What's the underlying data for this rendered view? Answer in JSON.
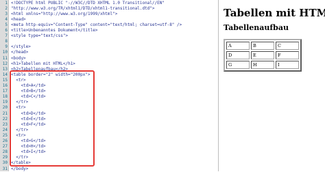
{
  "editor": {
    "lines": [
      {
        "n": "1",
        "text": "<!DOCTYPE html PUBLIC \"-//W3C//DTD XHTML 1.0 Transitional//EN\""
      },
      {
        "n": "2",
        "text": "\"http://www.w3.org/TR/xhtml1/DTD/xhtml1-transitional.dtd\">"
      },
      {
        "n": "3",
        "text": "<html xmlns=\"http://www.w3.org/1999/xhtml\">"
      },
      {
        "n": "4",
        "text": "<head>"
      },
      {
        "n": "5",
        "text": "<meta http-equiv=\"Content-Type\" content=\"text/html; charset=utf-8\" />"
      },
      {
        "n": "6",
        "text": "<title>Unbenanntes Dokument</title>"
      },
      {
        "n": "7",
        "text": "<style type=\"text/css\">"
      },
      {
        "n": "8",
        "text": ""
      },
      {
        "n": "9",
        "text": "</style>"
      },
      {
        "n": "10",
        "text": "</head>"
      },
      {
        "n": "11",
        "text": "<body>"
      },
      {
        "n": "12",
        "text": "<h1>Tabellen mit HTML</h1>"
      },
      {
        "n": "13",
        "text": "<h2>Tabellenaufbau</h2>"
      },
      {
        "n": "14",
        "text": "<table border=\"2\" width=\"200px\">"
      },
      {
        "n": "15",
        "text": "  <tr>"
      },
      {
        "n": "16",
        "text": "    <td>A</td>"
      },
      {
        "n": "17",
        "text": "    <td>B</td>"
      },
      {
        "n": "18",
        "text": "    <td>C</td>"
      },
      {
        "n": "19",
        "text": "  </tr>"
      },
      {
        "n": "20",
        "text": "  <tr>"
      },
      {
        "n": "21",
        "text": "    <td>D</td>"
      },
      {
        "n": "22",
        "text": "    <td>E</td>"
      },
      {
        "n": "23",
        "text": "    <td>F</td>"
      },
      {
        "n": "24",
        "text": "  </tr>"
      },
      {
        "n": "25",
        "text": "  <tr>"
      },
      {
        "n": "26",
        "text": "    <td>G</td>"
      },
      {
        "n": "27",
        "text": "    <td>H</td>"
      },
      {
        "n": "28",
        "text": "    <td>I</td>"
      },
      {
        "n": "29",
        "text": "  </tr>"
      },
      {
        "n": "30",
        "text": "</table>"
      },
      {
        "n": "31",
        "text": "</body>"
      }
    ]
  },
  "preview": {
    "heading1": "Tabellen mit HTML",
    "heading2": "Tabellenaufbau",
    "table": [
      [
        "A",
        "B",
        "C"
      ],
      [
        "D",
        "E",
        "F"
      ],
      [
        "G",
        "H",
        "I"
      ]
    ]
  },
  "colors": {
    "highlight_border": "#e53935",
    "line_number": "#1c6f8c",
    "code_text": "#283593"
  }
}
